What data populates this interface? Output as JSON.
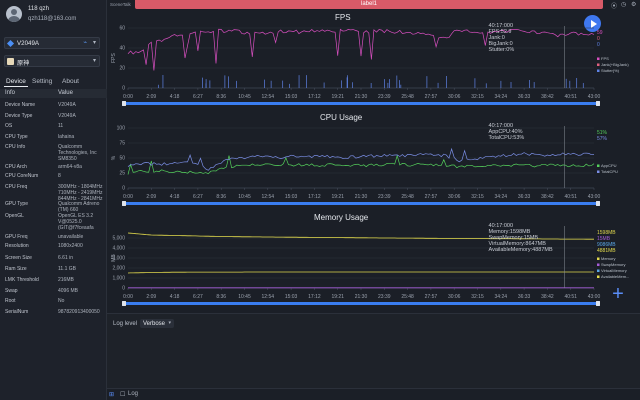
{
  "profile": {
    "username": "118 qzh",
    "email": "qzh118@163.com"
  },
  "device_select": {
    "value": "V2049A"
  },
  "app_select": {
    "value": "原神"
  },
  "tabs": {
    "device": "Device",
    "setting": "Setting",
    "about": "About"
  },
  "info_table": {
    "header_info": "Info",
    "header_value": "Value",
    "rows": [
      {
        "k": "Device Name",
        "v": "V2049A"
      },
      {
        "k": "Device Type",
        "v": "V2049A"
      },
      {
        "k": "OS",
        "v": "11"
      },
      {
        "k": "CPU Type",
        "v": "lahaina"
      },
      {
        "k": "CPU Info",
        "v": "Qualcomm\nTechnologies, Inc\nSM8350"
      },
      {
        "k": "CPU Arch",
        "v": "arm64-v8a"
      },
      {
        "k": "CPU CoreNum",
        "v": "8"
      },
      {
        "k": "CPU Freq",
        "v": "300MHz - 1804MHz\n710MHz - 2419MHz\n844MHz - 2841MHz"
      },
      {
        "k": "GPU Type",
        "v": "Qualcomm Adreno\n(TM) 660"
      },
      {
        "k": "OpenGL",
        "v": "OpenGL ES 3.2\nV@0525.0\n(GIT@f7fceaafa"
      },
      {
        "k": "GPU Freq",
        "v": "unavailable"
      },
      {
        "k": "Resolution",
        "v": "1080x2400"
      },
      {
        "k": "Screen Size",
        "v": "6.61 in"
      },
      {
        "k": "Ram Size",
        "v": "11.1 GB"
      },
      {
        "k": "LMK Threshold",
        "v": "216MB"
      },
      {
        "k": "Swap",
        "v": "4096 MB"
      },
      {
        "k": "Root",
        "v": "No"
      },
      {
        "k": "SerialNum",
        "v": "987820913400050"
      }
    ]
  },
  "header": {
    "scene_tab": "SceneTalk",
    "label": "label1"
  },
  "colors": {
    "fps": "#d84fc0",
    "jank": "#e06080",
    "stutter": "#5f83e6",
    "app_cpu": "#55d15c",
    "total_cpu": "#7b8fe6",
    "memory": "#e0d74d",
    "swap": "#a55dd8",
    "virtual": "#5aa7e6",
    "available": "#e6de4d"
  },
  "chart_data": [
    {
      "type": "line",
      "title": "FPS",
      "ylabel": "FPS",
      "ylim": [
        0,
        60
      ],
      "yticks": [
        "0",
        "20",
        "40",
        "60"
      ],
      "xticks": [
        "0:00",
        "2:09",
        "4:18",
        "6:27",
        "8:36",
        "10:45",
        "12:54",
        "15:03",
        "17:12",
        "19:21",
        "21:30",
        "23:39",
        "25:48",
        "27:57",
        "30:06",
        "32:15",
        "34:24",
        "36:33",
        "38:42",
        "40:51",
        "43:00"
      ],
      "end_values": [
        "59",
        "0",
        "0"
      ],
      "tooltip": [
        "40:17:000",
        "FPS:52.9",
        "Jank:0",
        "BigJank:0",
        "Stutter:0%"
      ],
      "legend": [
        "FPS",
        "Jank(+BigJank)",
        "Stutter(%)"
      ],
      "series": [
        {
          "name": "FPS",
          "values": [
            36,
            35,
            47,
            48,
            52,
            55,
            57,
            56,
            57,
            57,
            56,
            55,
            55,
            56,
            57,
            56,
            57,
            58,
            57,
            58,
            57,
            56,
            57,
            57,
            56,
            55,
            54,
            52,
            50,
            58,
            57,
            56,
            55,
            57,
            57,
            56,
            55,
            56,
            52,
            55,
            53,
            54
          ]
        }
      ]
    },
    {
      "type": "line",
      "title": "CPU Usage",
      "ylabel": "%",
      "ylim": [
        0,
        100
      ],
      "yticks": [
        "0",
        "25",
        "50",
        "75",
        "100"
      ],
      "xticks": [
        "0:00",
        "2:09",
        "4:18",
        "6:27",
        "8:36",
        "10:45",
        "12:54",
        "15:03",
        "17:12",
        "19:21",
        "21:30",
        "23:39",
        "25:48",
        "27:57",
        "30:06",
        "32:15",
        "34:24",
        "36:33",
        "38:42",
        "40:51",
        "43:00"
      ],
      "end_values": [
        "51%",
        "57%"
      ],
      "tooltip": [
        "40:17:000",
        "AppCPU:40%",
        "TotalCPU:53%"
      ],
      "legend": [
        "AppCPU",
        "TotalCPU"
      ],
      "series": [
        {
          "name": "AppCPU",
          "values": [
            25,
            27,
            27,
            28,
            26,
            27,
            26,
            24,
            33,
            36,
            37,
            38,
            38,
            39,
            38,
            38,
            39,
            38,
            39,
            38,
            38,
            38,
            39,
            39,
            39,
            38,
            39,
            39,
            38,
            36,
            36,
            37,
            37,
            38,
            38,
            38,
            37,
            38,
            38,
            37,
            38,
            39
          ]
        },
        {
          "name": "TotalCPU",
          "values": [
            38,
            41,
            40,
            40,
            41,
            42,
            43,
            30,
            42,
            48,
            49,
            52,
            54,
            51,
            52,
            53,
            53,
            52,
            52,
            51,
            52,
            53,
            54,
            54,
            54,
            55,
            55,
            55,
            54,
            46,
            47,
            50,
            53,
            54,
            56,
            57,
            55,
            55,
            56,
            57,
            56,
            58
          ]
        }
      ]
    },
    {
      "type": "line",
      "title": "Memory Usage",
      "ylabel": "MB",
      "ylim": [
        0,
        6000
      ],
      "yticks": [
        "0",
        "1,000",
        "2,000",
        "3,000",
        "4,000",
        "5,000"
      ],
      "xticks": [
        "0:00",
        "2:09",
        "4:18",
        "6:27",
        "8:36",
        "10:45",
        "12:54",
        "15:03",
        "17:12",
        "19:21",
        "21:30",
        "23:39",
        "25:48",
        "27:57",
        "30:06",
        "32:15",
        "34:24",
        "36:33",
        "38:42",
        "40:51",
        "43:00"
      ],
      "end_values": [
        "1598MB",
        "15MB",
        "9086MB",
        "4881MB"
      ],
      "tooltip": [
        "40:17:000",
        "Memory:1598MB",
        "SwapMemory:15MB",
        "VirtualMemory:8647MB",
        "AvailableMemory:4887MB"
      ],
      "legend": [
        "Memory",
        "SwapMemory",
        "VirtualMemory",
        "AvailableMem..."
      ],
      "series": [
        {
          "name": "Memory",
          "values": [
            1500,
            1550,
            1580,
            1590,
            1590,
            1595,
            1596,
            1597,
            1597,
            1598,
            1598,
            1598,
            1598,
            1598,
            1598,
            1598,
            1598,
            1598,
            1598,
            1598,
            1598
          ]
        },
        {
          "name": "SwapMemory",
          "values": [
            15,
            15,
            15,
            15,
            15,
            15,
            15,
            15,
            15,
            15,
            15,
            15,
            15,
            15,
            15,
            15,
            15,
            15,
            15,
            15,
            15
          ]
        },
        {
          "name": "AvailableMemory",
          "values": [
            5500,
            5300,
            5250,
            5200,
            5150,
            5120,
            5100,
            5080,
            5060,
            5040,
            5020,
            5000,
            4990,
            4970,
            4950,
            4940,
            4930,
            4920,
            4900,
            4890,
            4881
          ]
        }
      ]
    }
  ],
  "log": {
    "level_label": "Log level",
    "level_value": "Verbose"
  },
  "bottom": {
    "log_label": "Log"
  }
}
